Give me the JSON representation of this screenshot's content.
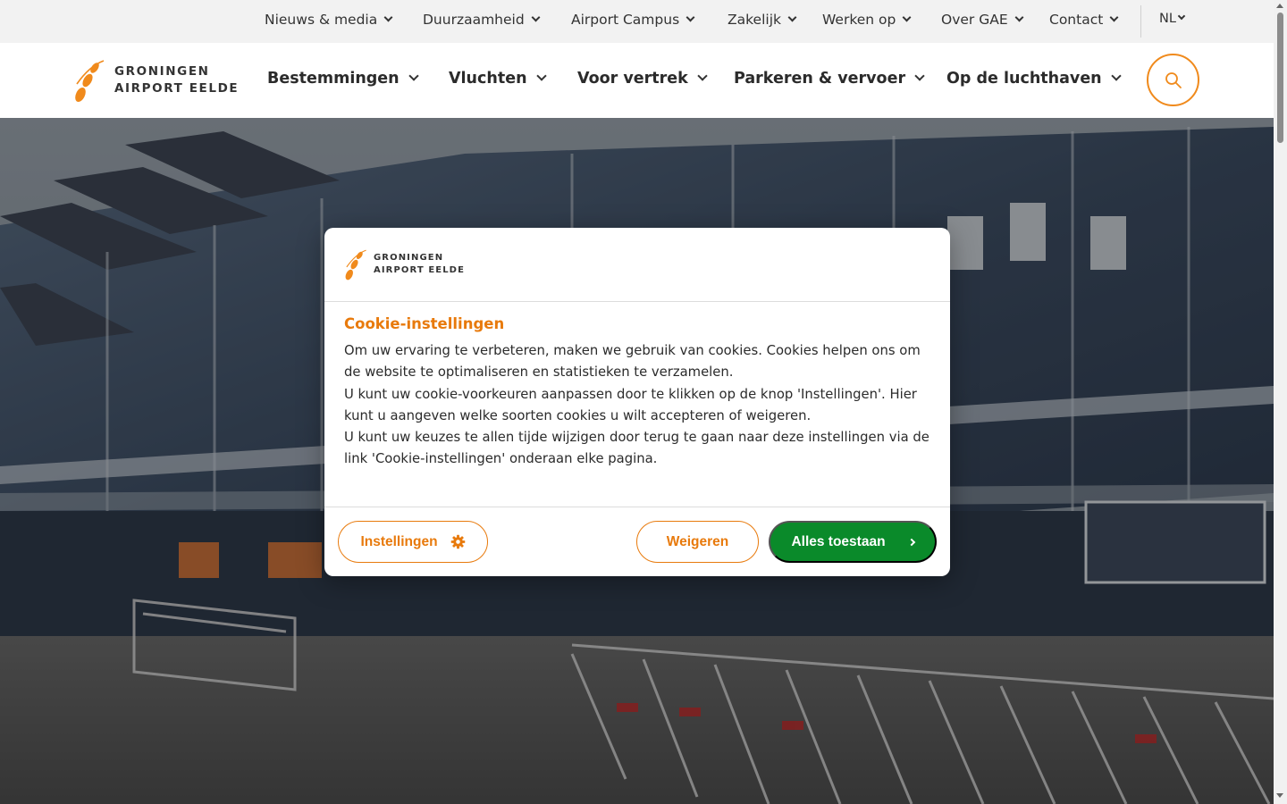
{
  "colors": {
    "brand_orange": "#f08a1c",
    "accent_orange_text": "#e87a0c",
    "accept_green": "#0a8a2a",
    "topbar_bg": "#f2f2f2"
  },
  "logo": {
    "line1": "GRONINGEN",
    "line2": "AIRPORT EELDE"
  },
  "topnav": {
    "items": [
      {
        "label": "Nieuws & media"
      },
      {
        "label": "Duurzaamheid"
      },
      {
        "label": "Airport Campus"
      },
      {
        "label": "Zakelijk"
      },
      {
        "label": "Werken op"
      },
      {
        "label": "Over GAE"
      },
      {
        "label": "Contact"
      }
    ],
    "language": "NL"
  },
  "mainnav": {
    "items": [
      {
        "label": "Bestemmingen"
      },
      {
        "label": "Vluchten"
      },
      {
        "label": "Voor vertrek"
      },
      {
        "label": "Parkeren & vervoer"
      },
      {
        "label": "Op de luchthaven"
      }
    ],
    "search_icon": "search-icon"
  },
  "cookie": {
    "title": "Cookie-instellingen",
    "paragraphs": [
      "Om uw ervaring te verbeteren, maken we gebruik van cookies. Cookies helpen ons om de website te optimaliseren en statistieken te verzamelen.",
      "U kunt uw cookie-voorkeuren aanpassen door te klikken op de knop 'Instellingen'. Hier kunt u aangeven welke soorten cookies u wilt accepteren of weigeren.",
      "U kunt uw keuzes te allen tijde wijzigen door terug te gaan naar deze instellingen via de link 'Cookie-instellingen' onderaan elke pagina."
    ],
    "buttons": {
      "settings": "Instellingen",
      "decline": "Weigeren",
      "accept": "Alles toestaan"
    }
  }
}
